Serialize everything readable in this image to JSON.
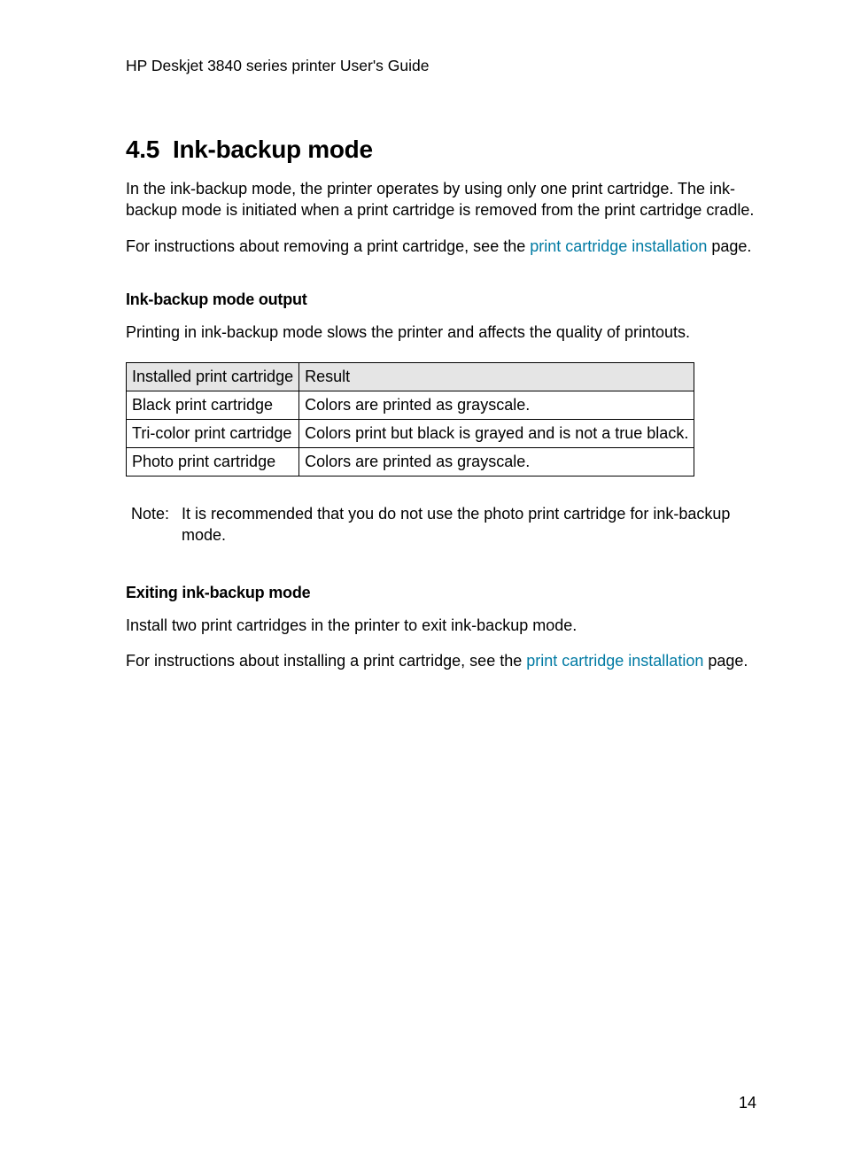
{
  "header": "HP Deskjet 3840 series printer User's Guide",
  "section_number": "4.5",
  "section_title": "Ink-backup mode",
  "intro_para": "In the ink-backup mode, the printer operates by using only one print cartridge. The ink-backup mode is initiated when a print cartridge is removed from the print cartridge cradle.",
  "instr_para_pre": "For instructions about removing a print cartridge, see the ",
  "instr_link": "print cartridge installation",
  "instr_para_post": " page.",
  "output_heading": "Ink-backup mode output",
  "output_para": "Printing in ink-backup mode slows the printer and affects the quality of printouts.",
  "table": {
    "head_col1": "Installed print cartridge",
    "head_col2": "Result",
    "rows": [
      {
        "c1": "Black print cartridge",
        "c2": "Colors are printed as grayscale."
      },
      {
        "c1": "Tri-color print cartridge",
        "c2": "Colors print but black is grayed and is not a true black."
      },
      {
        "c1": "Photo print cartridge",
        "c2": "Colors are printed as grayscale."
      }
    ]
  },
  "note_label": "Note:",
  "note_text": "It is recommended that you do not use the photo print cartridge for ink-backup mode.",
  "exit_heading": "Exiting ink-backup mode",
  "exit_para1": "Install two print cartridges in the printer to exit ink-backup mode.",
  "exit_para2_pre": "For instructions about installing a print cartridge, see the ",
  "exit_link": "print cartridge installation",
  "exit_para2_post": " page.",
  "page_number": "14"
}
